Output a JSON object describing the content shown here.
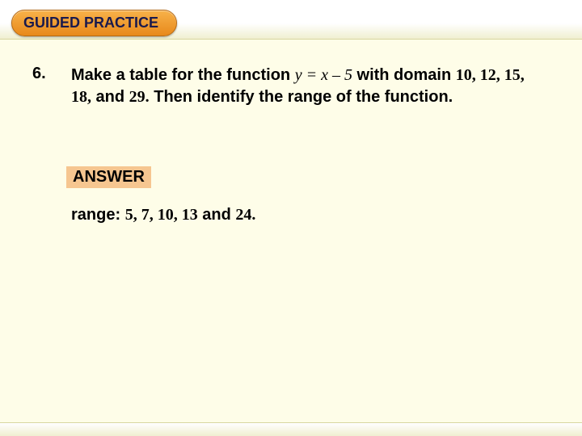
{
  "header": {
    "pill_label": "GUIDED PRACTICE"
  },
  "question": {
    "number": "6.",
    "part1": "Make a table for the function ",
    "func": "y = x – 5",
    "part2": " with domain ",
    "domain_list": "10, 12, 15, 18,",
    "and1": " and ",
    "last_domain": "29.",
    "part3": " Then identify the range of the function."
  },
  "answer": {
    "label": "ANSWER",
    "lead": "range: ",
    "range_list": "5, 7, 10, 13",
    "and": " and ",
    "last_range": "24."
  }
}
